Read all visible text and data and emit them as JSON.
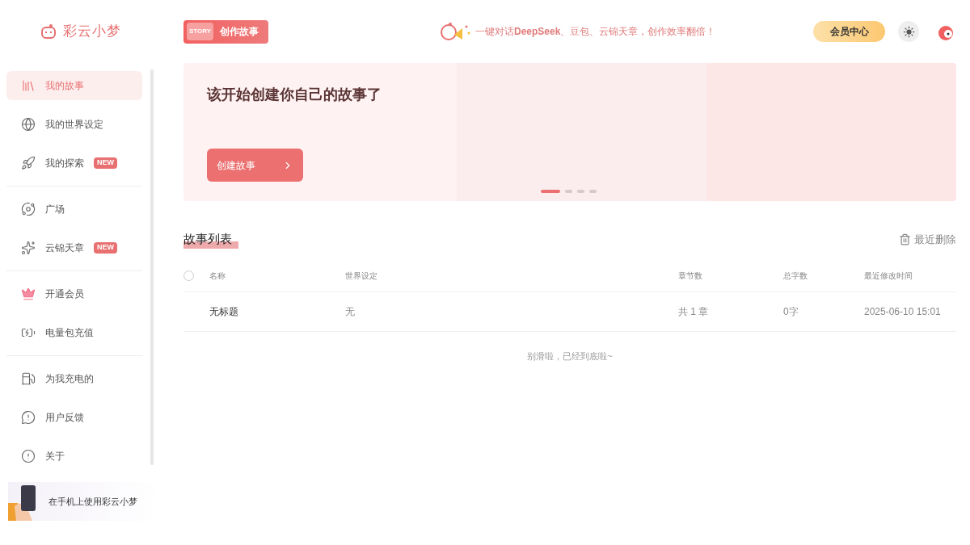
{
  "logo": {
    "name": "彩云小梦"
  },
  "header": {
    "create_button": "创作故事",
    "create_badge": "STORY",
    "promo": "一键对话**DeepSeek**、豆包、云锦天章，创作效率翻倍！",
    "vip_button": "会员中心"
  },
  "sidebar": {
    "groups": [
      {
        "items": [
          {
            "label": "我的故事",
            "kind": "book",
            "selected": true
          },
          {
            "label": "我的世界设定",
            "kind": "globe",
            "selected": false
          },
          {
            "label": "我的探索",
            "kind": "ufo",
            "badge": "NEW",
            "selected": false
          }
        ]
      },
      {
        "items": [
          {
            "label": "广场",
            "kind": "planet",
            "selected": false
          },
          {
            "label": "云锦天章",
            "kind": "swirl",
            "badge": "NEW",
            "selected": false
          }
        ]
      },
      {
        "items": [
          {
            "label": "开通会员",
            "kind": "crown",
            "selected": false
          },
          {
            "label": "电量包充值",
            "kind": "battery",
            "selected": false
          }
        ]
      },
      {
        "items": [
          {
            "label": "为我充电的",
            "kind": "charger",
            "selected": false
          },
          {
            "label": "用户反馈",
            "kind": "feedback",
            "selected": false
          },
          {
            "label": "关于",
            "kind": "info",
            "selected": false
          }
        ]
      }
    ],
    "mobile_banner": "在手机上使用彩云小梦"
  },
  "banner": {
    "title": "该开始创建你自己的故事了",
    "button": "创建故事",
    "slides": [
      {
        "selected": true
      },
      {
        "selected": false
      },
      {
        "selected": false
      },
      {
        "selected": false
      }
    ]
  },
  "story_list": {
    "title": "故事列表",
    "recent_deleted": "最近删除",
    "select_all_checked": false,
    "columns": [
      "名称",
      "世界设定",
      "章节数",
      "总字数",
      "最近修改时间"
    ],
    "rows": [
      {
        "cells": [
          "无标题",
          "无",
          "共 1 章",
          "0字",
          "2025-06-10 15:01"
        ]
      }
    ],
    "footer": "别滑啦，已经到底啦~"
  }
}
